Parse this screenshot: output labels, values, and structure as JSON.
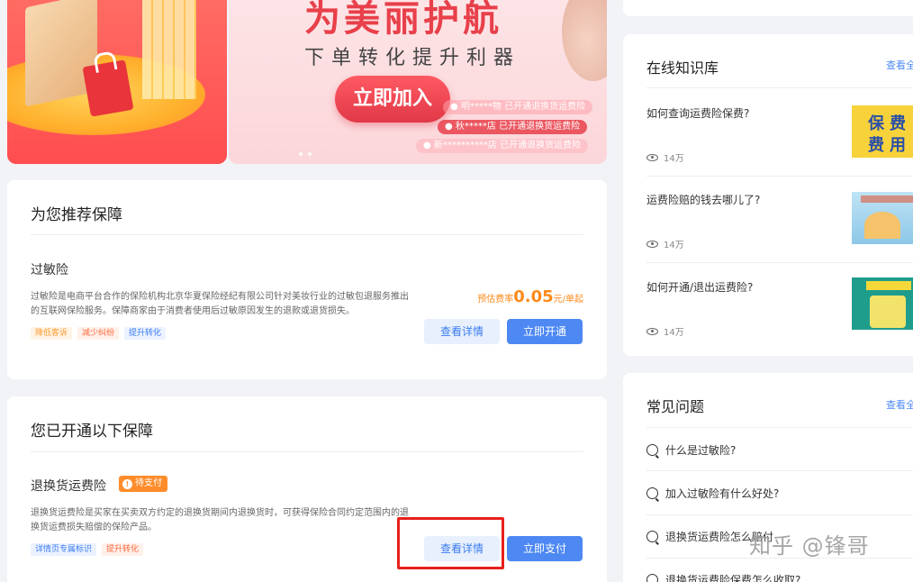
{
  "banner": {
    "title": "为美丽护航",
    "subtitle": "下单转化提升利器",
    "cta": "立即加入",
    "tickers": [
      "● 明*****物 已开通退换货运费险",
      "● 秋*****店 已开通退换货运费险",
      "● 新**********店 已开通退换货运费险"
    ]
  },
  "recommend": {
    "title": "为您推荐保障",
    "item": {
      "name": "过敏险",
      "desc": "过敏险是电商平台合作的保险机构北京华夏保险经纪有限公司针对美妆行业的过敏包退服务推出的互联网保险服务。保障商家由于消费者使用后过敏原因发生的退款或退货损失。",
      "tags": [
        "降低客诉",
        "减少纠纷",
        "提升转化"
      ],
      "price_prefix": "预估费率",
      "price_value": "0.05",
      "price_unit": "元/单起",
      "detail_btn": "查看详情",
      "open_btn": "立即开通"
    }
  },
  "opened": {
    "title": "您已开通以下保障",
    "item": {
      "name": "退换货运费险",
      "badge": "待支付",
      "desc": "退换货运费险是买家在买卖双方约定的退换货期间内退换货时，可获得保险合同约定范围内的退换货运费损失赔偿的保险产品。",
      "tags": [
        "详情页专属标识",
        "提升转化"
      ],
      "detail_btn": "查看详情",
      "pay_btn": "立即支付"
    }
  },
  "knowledge": {
    "title": "在线知识库",
    "more": "查看全",
    "items": [
      {
        "question": "如何查询运费险保费?",
        "views": "14万",
        "thumb_text": "保 费\n费 用"
      },
      {
        "question": "运费险赔的钱去哪儿了?",
        "views": "14万"
      },
      {
        "question": "如何开通/退出运费险?",
        "views": "14万"
      }
    ]
  },
  "faq": {
    "title": "常见问题",
    "more": "查看全",
    "items": [
      "什么是过敏险?",
      "加入过敏险有什么好处?",
      "退换货运费险怎么赔付",
      "退换货运费险保费怎么收取?"
    ]
  },
  "watermark": "知乎 @锋哥"
}
